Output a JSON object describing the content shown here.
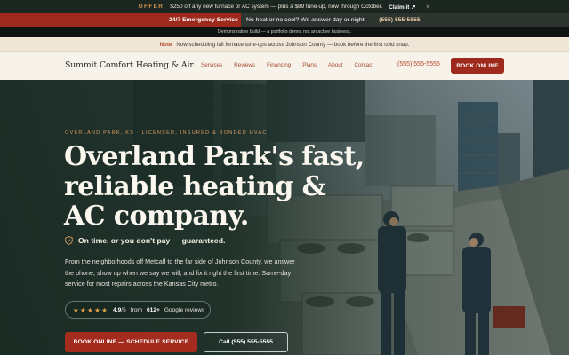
{
  "offer_bar": {
    "tag": "OFFER",
    "message": "$250 off any new furnace or AC system — plus a $89 tune-up, now through October.",
    "claim_label": "Claim it ↗",
    "close_icon": "close-icon"
  },
  "emergency_bar": {
    "title": "24/7 Emergency Service",
    "message": "No heat or no cool? We answer day or night —",
    "phone": "(555) 555-5555"
  },
  "demo_bar": {
    "text": "Demonstration build — a portfolio demo, not an active business."
  },
  "note_bar": {
    "label": "Note",
    "text": "Now scheduling fall furnace tune-ups across Johnson County — book before the first cold snap."
  },
  "nav": {
    "brand": "Summit Comfort Heating & Air",
    "links": [
      "Services",
      "Reviews",
      "Financing",
      "Plans",
      "About",
      "Contact"
    ],
    "phone": "(555) 555-5555",
    "book_label": "BOOK ONLINE"
  },
  "hero": {
    "eyebrow": "OVERLAND PARK, KS · LICENSED, INSURED & BONDED HVAC",
    "headline": "Overland Park's fast, reliable heating & AC company.",
    "guarantee_icon": "shield-icon",
    "guarantee": "On time, or you don't pay — guaranteed.",
    "lede": "From the neighborhoods off Metcalf to the far side of Johnson County, we answer the phone, show up when we say we will, and fix it right the first time. Same-day service for most repairs across the Kansas City metro.",
    "rating": {
      "stars": "★★★★★",
      "score": "4.9",
      "score_suffix": "/5",
      "count_prefix": "from",
      "count": "612+",
      "count_suffix": "Google reviews"
    },
    "cta_primary": "BOOK ONLINE — SCHEDULE SERVICE",
    "cta_secondary": "Call (555) 555-5555"
  },
  "colors": {
    "brand_red": "#9e2a1d",
    "hero_green": "#1f2d27",
    "accent_gold": "#d79a5e",
    "cream": "#f8f3ea"
  }
}
